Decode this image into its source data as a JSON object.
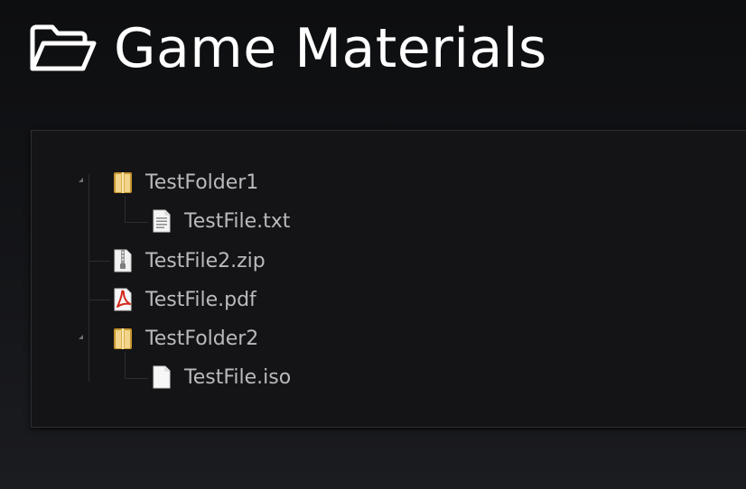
{
  "header": {
    "title": "Game Materials",
    "icon": "folder-open-icon"
  },
  "tree": {
    "items": [
      {
        "label": "TestFolder1",
        "type": "folder",
        "icon": "folder-icon",
        "expanded": true,
        "depth": 0
      },
      {
        "label": "TestFile.txt",
        "type": "file",
        "icon": "text-file-icon",
        "depth": 1
      },
      {
        "label": "TestFile2.zip",
        "type": "file",
        "icon": "zip-file-icon",
        "depth": 0
      },
      {
        "label": "TestFile.pdf",
        "type": "file",
        "icon": "pdf-file-icon",
        "depth": 0
      },
      {
        "label": "TestFolder2",
        "type": "folder",
        "icon": "folder-icon",
        "expanded": true,
        "depth": 0
      },
      {
        "label": "TestFile.iso",
        "type": "file",
        "icon": "blank-file-icon",
        "depth": 1
      }
    ]
  },
  "colors": {
    "background": "#111214",
    "panel": "#141416",
    "text": "#b9babc",
    "title": "#ffffff",
    "folder": "#e9c46a",
    "pdf": "#d42a1e"
  }
}
